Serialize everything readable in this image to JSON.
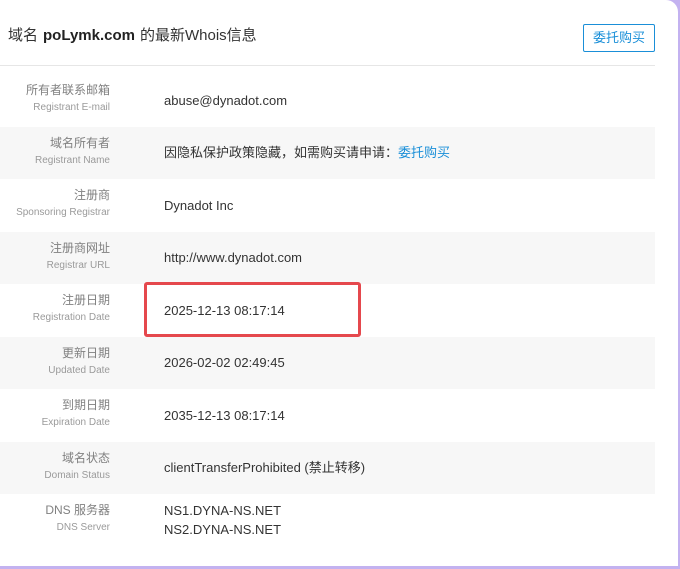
{
  "header": {
    "title_prefix": "域名",
    "domain": "poLymk.com",
    "title_suffix": "的最新Whois信息",
    "buy_button_label": "委托购买"
  },
  "rows": [
    {
      "label_cn": "所有者联系邮箱",
      "label_en": "Registrant E-mail",
      "value": "abuse@dynadot.com"
    },
    {
      "label_cn": "域名所有者",
      "label_en": "Registrant Name",
      "value": "因隐私保护政策隐藏，如需购买请申请：",
      "link": "委托购买"
    },
    {
      "label_cn": "注册商",
      "label_en": "Sponsoring Registrar",
      "value": "Dynadot Inc"
    },
    {
      "label_cn": "注册商网址",
      "label_en": "Registrar URL",
      "value": "http://www.dynadot.com"
    },
    {
      "label_cn": "注册日期",
      "label_en": "Registration Date",
      "value": "2025-12-13 08:17:14"
    },
    {
      "label_cn": "更新日期",
      "label_en": "Updated Date",
      "value": "2026-02-02 02:49:45"
    },
    {
      "label_cn": "到期日期",
      "label_en": "Expiration Date",
      "value": "2035-12-13 08:17:14"
    },
    {
      "label_cn": "域名状态",
      "label_en": "Domain Status",
      "value": "clientTransferProhibited (禁止转移)"
    },
    {
      "label_cn": "DNS 服务器",
      "label_en": "DNS Server",
      "values": [
        "NS1.DYNA-NS.NET",
        "NS2.DYNA-NS.NET"
      ]
    }
  ],
  "colors": {
    "accent": "#1a8fd8",
    "highlight": "#e5484d",
    "alt_row": "#f7f7f7",
    "page_background": "#c3b2f0"
  }
}
